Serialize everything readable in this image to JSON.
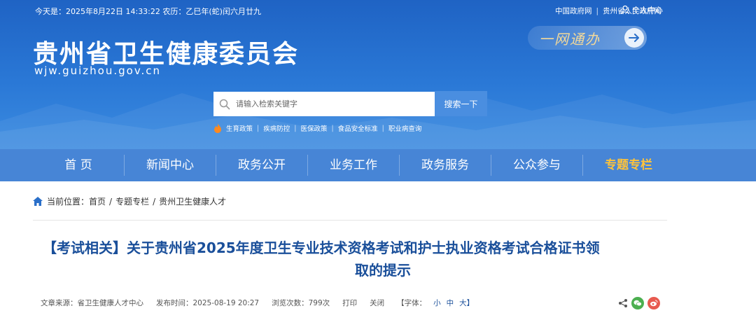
{
  "topbar": {
    "date_text": "今天是：2025年8月22日  14:33:22  农历：乙巳年(蛇)闰六月廿九",
    "links": [
      "中国政府网",
      "贵州省人民政府网"
    ],
    "user_center": "个人中心"
  },
  "site": {
    "title": "贵州省卫生健康委员会",
    "domain": "wjw.guizhou.gov.cn",
    "one_net": "一网通办"
  },
  "search": {
    "placeholder": "请输入检索关键字",
    "button_label": "搜索一下",
    "hot_words": [
      "生育政策",
      "疾病防控",
      "医保政策",
      "食品安全标准",
      "职业病查询"
    ]
  },
  "nav": {
    "items": [
      "首 页",
      "新闻中心",
      "政务公开",
      "业务工作",
      "政务服务",
      "公众参与",
      "专题专栏"
    ]
  },
  "breadcrumb": {
    "label": "当前位置：",
    "items": [
      "首页",
      "专题专栏",
      "贵州卫生健康人才"
    ]
  },
  "article": {
    "title_line1": "【考试相关】关于贵州省2025年度卫生专业技术资格考试和护士执业资格考试合格证书领",
    "title_line2": "取的提示",
    "source": "文章来源：省卫生健康人才中心",
    "publish_time": "发布时间：2025-08-19 20:27",
    "views": "浏览次数：799次",
    "print": "打印",
    "close": "关闭",
    "font_label": "【字体：",
    "font_small": "小",
    "font_medium": "中",
    "font_large": "大】"
  },
  "colors": {
    "header_blue": "#2a78d6",
    "nav_blue": "#4785d6",
    "title_blue": "#1a4f9a",
    "special_nav": "#ffc33a",
    "wechat": "#4caf50",
    "weibo": "#e85a4f"
  }
}
